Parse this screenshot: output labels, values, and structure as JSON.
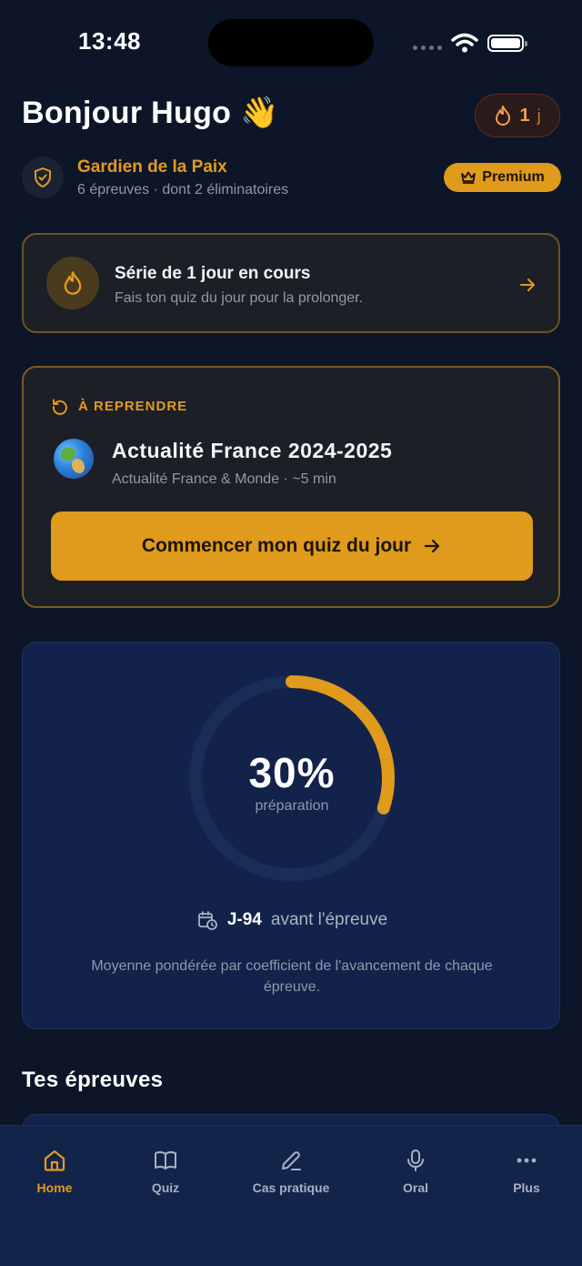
{
  "status": {
    "time": "13:48"
  },
  "header": {
    "greeting": "Bonjour Hugo 👋",
    "streak_count": "1",
    "streak_unit": "j"
  },
  "profile": {
    "title": "Gardien de la Paix",
    "subtitle": "6 épreuves · dont 2 éliminatoires",
    "badge": "Premium"
  },
  "streak_card": {
    "title": "Série de 1 jour en cours",
    "subtitle": "Fais ton quiz du jour pour la prolonger."
  },
  "resume_card": {
    "label": "À REPRENDRE",
    "title": "Actualité France 2024-2025",
    "subtitle": "Actualité France & Monde · ~5 min",
    "button": "Commencer mon quiz du jour"
  },
  "progress": {
    "percent_text": "30%",
    "percent_value": 0.3,
    "label": "préparation",
    "countdown_strong": "J-94",
    "countdown_rest": "avant l'épreuve",
    "footnote": "Moyenne pondérée par coefficient de l'avancement de chaque épreuve."
  },
  "section": {
    "title": "Tes épreuves"
  },
  "tabs": [
    {
      "label": "Home",
      "icon": "home-icon",
      "active": true
    },
    {
      "label": "Quiz",
      "icon": "book-icon",
      "active": false
    },
    {
      "label": "Cas pratique",
      "icon": "pencil-icon",
      "active": false
    },
    {
      "label": "Oral",
      "icon": "microphone-icon",
      "active": false
    },
    {
      "label": "Plus",
      "icon": "more-icon",
      "active": false
    }
  ],
  "colors": {
    "accent": "#e09a1c",
    "background": "#0c1628",
    "card": "#12224a"
  }
}
